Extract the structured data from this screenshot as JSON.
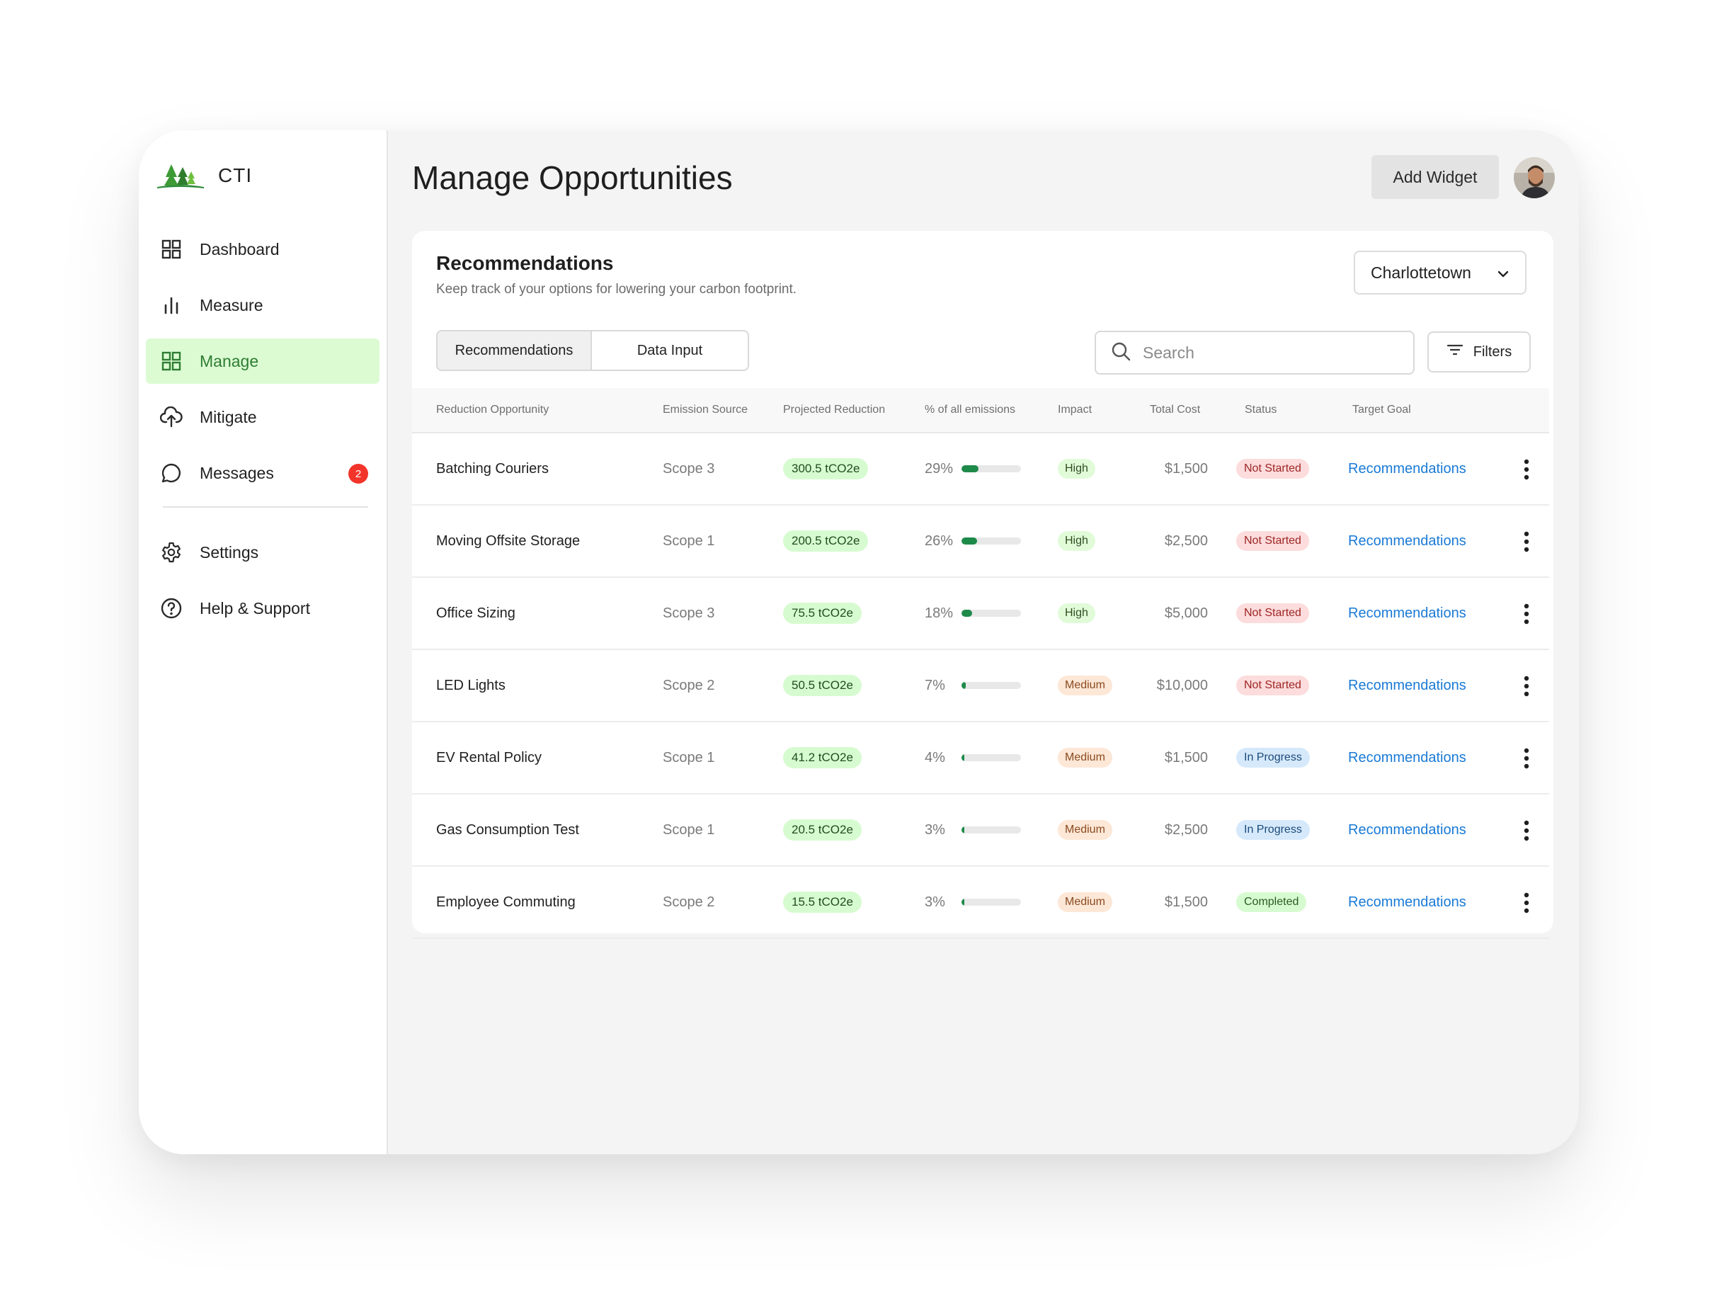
{
  "brand": {
    "name": "CTI",
    "logo_icon": "trees-logo-icon"
  },
  "sidebar": {
    "items": [
      {
        "label": "Dashboard",
        "icon": "grid-icon"
      },
      {
        "label": "Measure",
        "icon": "bar-chart-icon"
      },
      {
        "label": "Manage",
        "icon": "grid-icon",
        "active": true
      },
      {
        "label": "Mitigate",
        "icon": "cloud-upload-icon"
      },
      {
        "label": "Messages",
        "icon": "chat-bubble-icon",
        "badge": "2"
      }
    ],
    "footer_items": [
      {
        "label": "Settings",
        "icon": "gear-icon"
      },
      {
        "label": "Help & Support",
        "icon": "help-circle-icon"
      }
    ]
  },
  "header": {
    "title": "Manage Opportunities",
    "add_widget_label": "Add Widget"
  },
  "card": {
    "title": "Recommendations",
    "subtitle": "Keep track of your options for lowering your carbon footprint.",
    "location": "Charlottetown",
    "tabs": [
      {
        "label": "Recommendations",
        "active": true
      },
      {
        "label": "Data Input"
      }
    ],
    "search_placeholder": "Search",
    "filters_label": "Filters"
  },
  "table": {
    "columns": [
      "Reduction Opportunity",
      "Emission Source",
      "Projected Reduction",
      "% of all emissions",
      "Impact",
      "Total Cost",
      "Status",
      "Target Goal"
    ],
    "rows": [
      {
        "name": "Batching Couriers",
        "source": "Scope 3",
        "reduction": "300.5 tCO2e",
        "pct": "29%",
        "pct_value": 29,
        "impact": "High",
        "cost": "$1,500",
        "status": "Not Started",
        "goal": "Recommendations"
      },
      {
        "name": "Moving Offsite Storage",
        "source": "Scope 1",
        "reduction": "200.5 tCO2e",
        "pct": "26%",
        "pct_value": 26,
        "impact": "High",
        "cost": "$2,500",
        "status": "Not Started",
        "goal": "Recommendations"
      },
      {
        "name": "Office Sizing",
        "source": "Scope 3",
        "reduction": "75.5 tCO2e",
        "pct": "18%",
        "pct_value": 18,
        "impact": "High",
        "cost": "$5,000",
        "status": "Not Started",
        "goal": "Recommendations"
      },
      {
        "name": "LED Lights",
        "source": "Scope 2",
        "reduction": "50.5 tCO2e",
        "pct": "7%",
        "pct_value": 7,
        "impact": "Medium",
        "cost": "$10,000",
        "status": "Not Started",
        "goal": "Recommendations"
      },
      {
        "name": "EV Rental Policy",
        "source": "Scope 1",
        "reduction": "41.2 tCO2e",
        "pct": "4%",
        "pct_value": 4,
        "impact": "Medium",
        "cost": "$1,500",
        "status": "In Progress",
        "goal": "Recommendations"
      },
      {
        "name": "Gas Consumption Test",
        "source": "Scope 1",
        "reduction": "20.5 tCO2e",
        "pct": "3%",
        "pct_value": 3,
        "impact": "Medium",
        "cost": "$2,500",
        "status": "In Progress",
        "goal": "Recommendations"
      },
      {
        "name": "Employee Commuting",
        "source": "Scope 2",
        "reduction": "15.5 tCO2e",
        "pct": "3%",
        "pct_value": 3,
        "impact": "Medium",
        "cost": "$1,500",
        "status": "Completed",
        "goal": "Recommendations"
      }
    ]
  },
  "colors": {
    "accent_green": "#2e7d32",
    "active_bg": "#dcfbd3",
    "link_blue": "#1a7ad6",
    "badge_red": "#f2342b",
    "bar_green": "#1e8a4a"
  }
}
